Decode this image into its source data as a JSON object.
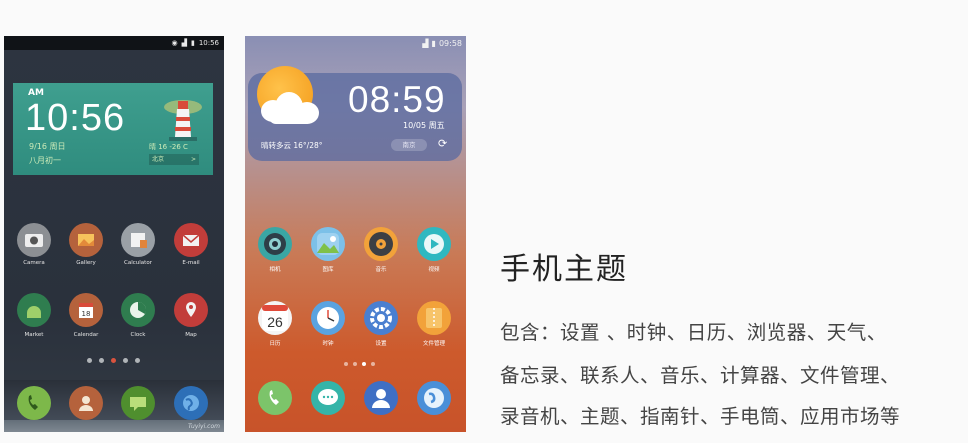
{
  "phone1": {
    "status_time": "10:56",
    "clock": {
      "ampm": "AM",
      "time": "10:56",
      "date": "9/16  周日",
      "lunar": "八月初一",
      "weather": "晴  16 -26 C",
      "city": "北京",
      "city_arrow": ">"
    },
    "apps_row1": [
      "Camera",
      "Gallery",
      "Calculator",
      "E-mail"
    ],
    "apps_row2": [
      "Market",
      "Calendar",
      "Clock",
      "Map"
    ],
    "calendar_day": "18",
    "page_dots": 5,
    "active_dot": 2,
    "watermark": "Tuyiyi.com"
  },
  "phone2": {
    "status_time": "09:58",
    "clock": {
      "time": "08:59",
      "date": "10/05  周五",
      "weather": "晴转多云  16°/28°",
      "city": "南京"
    },
    "apps_row1": [
      "相机",
      "图库",
      "音乐",
      "视频"
    ],
    "apps_row2": [
      "日历",
      "时钟",
      "设置",
      "文件管理"
    ],
    "calendar_day": "26",
    "page_dots": 4,
    "active_dot": 2
  },
  "text": {
    "title": "手机主题",
    "line1": "包含：设置 、时钟、日历、浏览器、天气、",
    "line2": "备忘录、联系人、音乐、计算器、文件管理、",
    "line3": "录音机、主题、指南针、手电筒、应用市场等"
  }
}
